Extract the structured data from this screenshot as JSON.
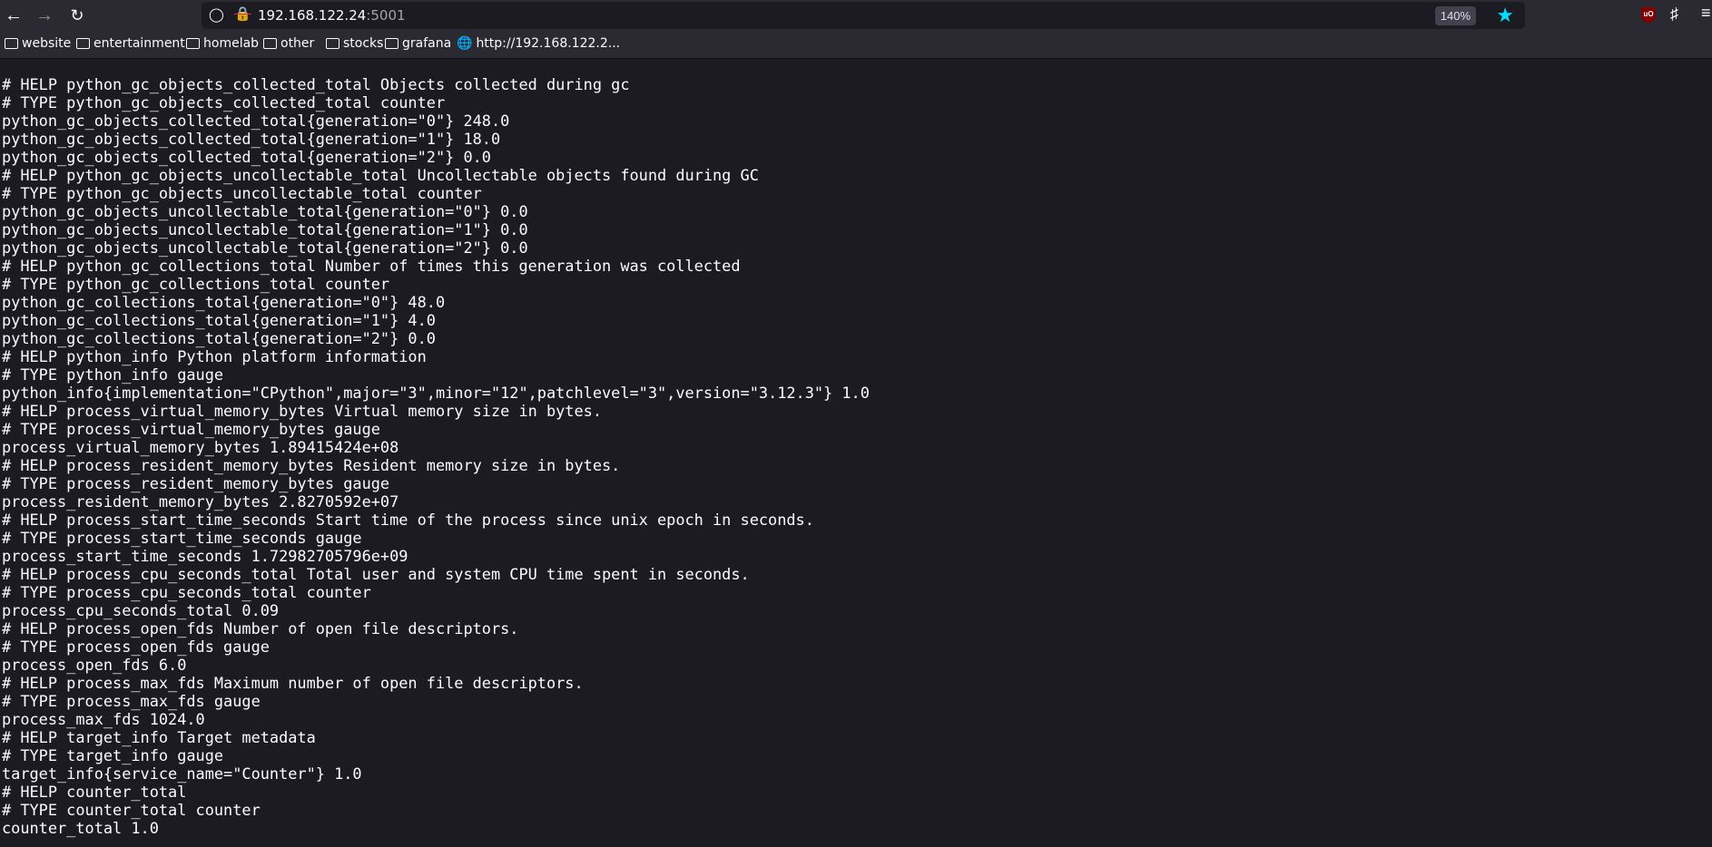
{
  "browser": {
    "url_host": "192.168.122.24",
    "url_port": ":5001",
    "zoom_level": "140%",
    "accent_color": "#00ddff",
    "bookmarks": [
      {
        "label": "website",
        "icon": "folder-icon"
      },
      {
        "label": "entertainment",
        "icon": "folder-icon"
      },
      {
        "label": "homelab",
        "icon": "folder-icon"
      },
      {
        "label": "other",
        "icon": "folder-icon"
      },
      {
        "label": "stocks",
        "icon": "folder-icon"
      },
      {
        "label": "grafana",
        "icon": "folder-icon"
      },
      {
        "label": "http://192.168.122.2...",
        "icon": "globe-icon"
      }
    ],
    "extension_badge": "uO"
  },
  "metrics_lines": [
    "# HELP python_gc_objects_collected_total Objects collected during gc",
    "# TYPE python_gc_objects_collected_total counter",
    "python_gc_objects_collected_total{generation=\"0\"} 248.0",
    "python_gc_objects_collected_total{generation=\"1\"} 18.0",
    "python_gc_objects_collected_total{generation=\"2\"} 0.0",
    "# HELP python_gc_objects_uncollectable_total Uncollectable objects found during GC",
    "# TYPE python_gc_objects_uncollectable_total counter",
    "python_gc_objects_uncollectable_total{generation=\"0\"} 0.0",
    "python_gc_objects_uncollectable_total{generation=\"1\"} 0.0",
    "python_gc_objects_uncollectable_total{generation=\"2\"} 0.0",
    "# HELP python_gc_collections_total Number of times this generation was collected",
    "# TYPE python_gc_collections_total counter",
    "python_gc_collections_total{generation=\"0\"} 48.0",
    "python_gc_collections_total{generation=\"1\"} 4.0",
    "python_gc_collections_total{generation=\"2\"} 0.0",
    "# HELP python_info Python platform information",
    "# TYPE python_info gauge",
    "python_info{implementation=\"CPython\",major=\"3\",minor=\"12\",patchlevel=\"3\",version=\"3.12.3\"} 1.0",
    "# HELP process_virtual_memory_bytes Virtual memory size in bytes.",
    "# TYPE process_virtual_memory_bytes gauge",
    "process_virtual_memory_bytes 1.89415424e+08",
    "# HELP process_resident_memory_bytes Resident memory size in bytes.",
    "# TYPE process_resident_memory_bytes gauge",
    "process_resident_memory_bytes 2.8270592e+07",
    "# HELP process_start_time_seconds Start time of the process since unix epoch in seconds.",
    "# TYPE process_start_time_seconds gauge",
    "process_start_time_seconds 1.72982705796e+09",
    "# HELP process_cpu_seconds_total Total user and system CPU time spent in seconds.",
    "# TYPE process_cpu_seconds_total counter",
    "process_cpu_seconds_total 0.09",
    "# HELP process_open_fds Number of open file descriptors.",
    "# TYPE process_open_fds gauge",
    "process_open_fds 6.0",
    "# HELP process_max_fds Maximum number of open file descriptors.",
    "# TYPE process_max_fds gauge",
    "process_max_fds 1024.0",
    "# HELP target_info Target metadata",
    "# TYPE target_info gauge",
    "target_info{service_name=\"Counter\"} 1.0",
    "# HELP counter_total",
    "# TYPE counter_total counter",
    "counter_total 1.0"
  ]
}
